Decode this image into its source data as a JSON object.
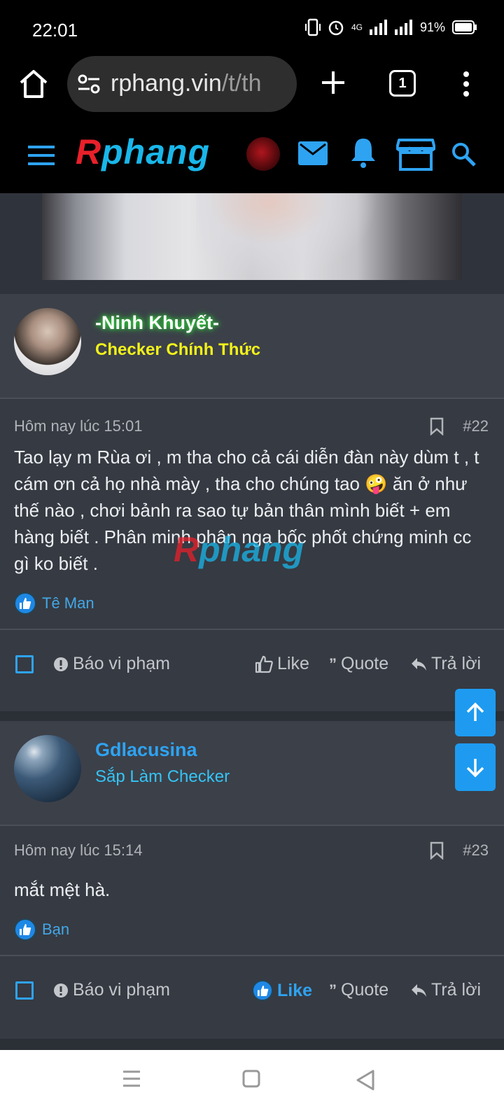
{
  "status_bar": {
    "time": "22:01",
    "network": "4G",
    "battery": "91%",
    "icons": [
      "vibrate-icon",
      "alarm-icon",
      "signal-icon",
      "battery-icon"
    ]
  },
  "browser": {
    "url_host": "rphang.vin",
    "url_path": "/t/th",
    "tab_count": "1"
  },
  "site": {
    "logo_r": "R",
    "logo_rest": "phang"
  },
  "posts": [
    {
      "user_name": "-Ninh Khuyết-",
      "user_name_color": "#ffffff",
      "user_title": "Checker Chính Thức",
      "user_title_color": "#f2f21a",
      "timestamp": "Hôm nay lúc 15:01",
      "number": "#22",
      "body": "Tao lạy m Rùa ơi , m tha cho cả cái diễn đàn này dùm t , t cám ơn cả họ nhà mày , tha cho chúng tao 🤪 ăn ở như thế nào , chơi bảnh ra sao tự bản thân mình biết + em hàng biết . Phân minh phân nga bốc phốt chứng minh cc gì ko biết .",
      "reaction_user": "Tê Man",
      "actions": {
        "report": "Báo vi phạm",
        "like": "Like",
        "quote": "Quote",
        "reply": "Trả lời"
      }
    },
    {
      "user_name": "Gdlacusina",
      "user_name_color": "#2ea3f2",
      "user_title": "Sắp Làm Checker",
      "user_title_color": "#35c4f5",
      "timestamp": "Hôm nay lúc 15:14",
      "number": "#23",
      "body": "mắt mệt hà.",
      "reaction_user": "Bạn",
      "actions": {
        "report": "Báo vi phạm",
        "like": "Like",
        "quote": "Quote",
        "reply": "Trả lời"
      }
    }
  ],
  "watermark": {
    "r": "R",
    "rest": "phang"
  }
}
